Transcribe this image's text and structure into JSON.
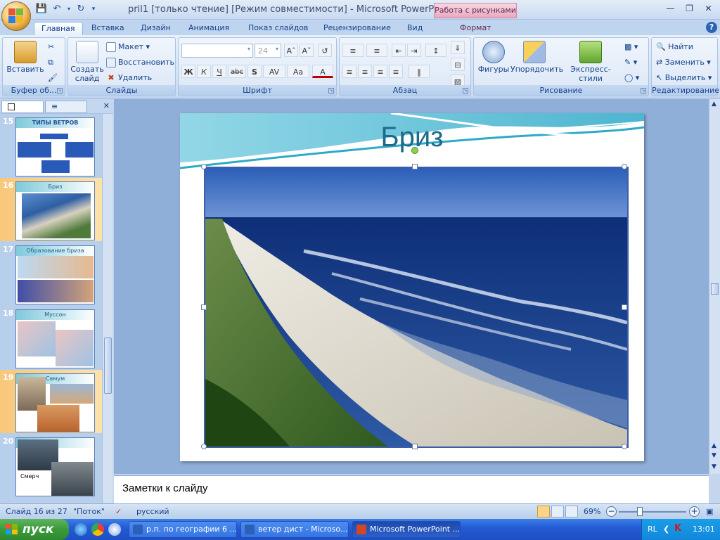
{
  "titlebar": {
    "title": "pril1 [только чтение] [Режим совместимости] - Microsoft PowerPoint",
    "contextual": "Работа с рисунками"
  },
  "tabs": [
    "Главная",
    "Вставка",
    "Дизайн",
    "Анимация",
    "Показ слайдов",
    "Рецензирование",
    "Вид",
    "Формат"
  ],
  "ribbon": {
    "clipboard": {
      "label": "Буфер об...",
      "paste": "Вставить"
    },
    "slides": {
      "label": "Слайды",
      "new_slide": "Создать слайд",
      "layout": "Макет",
      "reset": "Восстановить",
      "delete": "Удалить"
    },
    "font": {
      "label": "Шрифт",
      "size": "24",
      "bold": "Ж",
      "italic": "К",
      "underline": "Ч",
      "strike": "abc",
      "shadow": "S"
    },
    "paragraph": {
      "label": "Абзац"
    },
    "drawing": {
      "label": "Рисование",
      "shapes": "Фигуры",
      "arrange": "Упорядочить",
      "quick_styles": "Экспресс-стили"
    },
    "editing": {
      "label": "Редактирование",
      "find": "Найти",
      "replace": "Заменить",
      "select": "Выделить"
    }
  },
  "thumbnails": [
    {
      "num": "15",
      "title": "ТИПЫ ВЕТРОВ"
    },
    {
      "num": "16",
      "title": "Бриз"
    },
    {
      "num": "17",
      "title": "Образование бриза"
    },
    {
      "num": "18",
      "title": "Муссон"
    },
    {
      "num": "19",
      "title": "Самум"
    },
    {
      "num": "20",
      "title": "Смерч"
    }
  ],
  "slide": {
    "title": "Бриз"
  },
  "notes": {
    "placeholder": "Заметки к слайду"
  },
  "statusbar": {
    "slide_of": "Слайд 16 из 27",
    "theme": "\"Поток\"",
    "language": "русский",
    "zoom": "69%"
  },
  "taskbar": {
    "start": "пуск",
    "tasks": [
      "р.п. по географии 6 ...",
      "ветер дист - Microso...",
      "Microsoft PowerPoint ..."
    ],
    "lang": "RL",
    "time": "13:01"
  }
}
